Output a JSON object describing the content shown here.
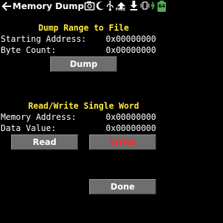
{
  "titlebar": {
    "title": "Memory Dump",
    "back_icon": "back-arrow-icon",
    "status_icons": [
      "camera-icon",
      "moon-icon",
      "usb-icon",
      "free-upload-icon",
      "download-icon",
      "vibrate-icon",
      "wifi-icon",
      "battery-icon"
    ],
    "free_label": "FREE",
    "battery_level": "64"
  },
  "dump_section": {
    "heading": "Dump Range to File",
    "start_label": "Starting Address:",
    "start_value": "0x00000000",
    "count_label": "Byte Count:",
    "count_value": "0x00000000",
    "dump_button": "Dump"
  },
  "rw_section": {
    "heading": "Read/Write Single Word",
    "addr_label": "Memory Address:",
    "addr_value": "0x00000000",
    "data_label": "Data Value:",
    "data_value": "0x00000000",
    "read_button": "Read",
    "write_button": "Write"
  },
  "done_button": "Done",
  "colors": {
    "heading": "#ffeb3b",
    "button_bg": "#6e6e6e",
    "write_text": "#ff2a2a",
    "battery": "#4caf50"
  }
}
